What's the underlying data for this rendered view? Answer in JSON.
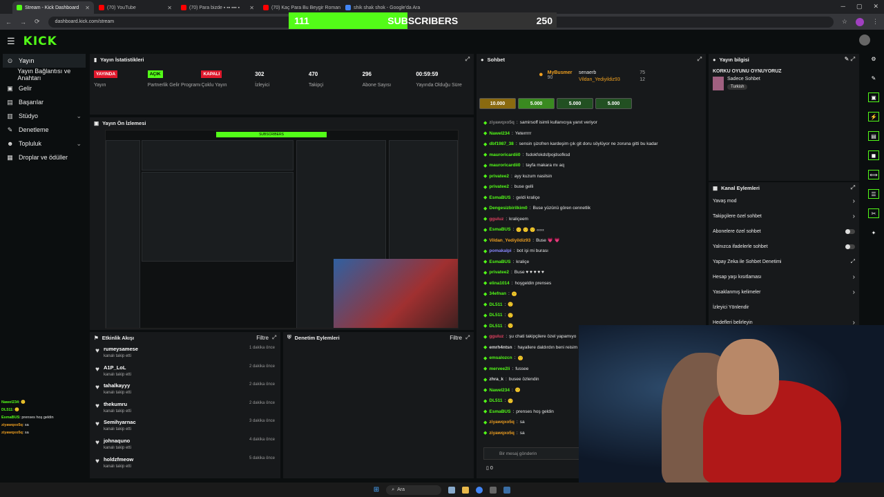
{
  "browser": {
    "tabs": [
      {
        "label": "Stream - Kick Dashboard",
        "color": "#53fc18"
      },
      {
        "label": "(70) YouTube",
        "color": "#ff0000"
      },
      {
        "label": "(70) Para bizde ▪ ▪▪ ▪▪▪ ▪",
        "color": "#ff0000"
      },
      {
        "label": "(70) Kaç Para Bu Beygir Romanl",
        "color": "#ff0000"
      },
      {
        "label": "shik shak shok - Google'da Ara",
        "color": "#4285f4"
      }
    ],
    "url": "dashboard.kick.com/stream"
  },
  "subs_goal": {
    "current": "111",
    "label": "SUBSCRIBERS",
    "goal": "250",
    "progress": 0.444
  },
  "brand": {
    "logo": "KICK"
  },
  "sidebar": {
    "items": [
      {
        "label": "Yayın",
        "icon": "⊙"
      },
      {
        "label": "Yayın Bağlantısı ve Anahtarı",
        "icon": ""
      },
      {
        "label": "Gelir",
        "icon": "▣"
      },
      {
        "label": "Başarılar",
        "icon": "▤"
      },
      {
        "label": "Stüdyo",
        "icon": "▥"
      },
      {
        "label": "Denetleme",
        "icon": "✎"
      },
      {
        "label": "Topluluk",
        "icon": "☻"
      },
      {
        "label": "Droplar ve ödüller",
        "icon": "▦"
      }
    ]
  },
  "stats": {
    "title": "Yayın İstatistikleri",
    "items": [
      {
        "value": "YAYINDA",
        "label": "Yayın",
        "badge": "red"
      },
      {
        "value": "AÇIK",
        "label": "Partnerlik Gelir Programı",
        "badge": "green"
      },
      {
        "value": "KAPALI",
        "label": "Çoklu Yayın",
        "badge": "red"
      },
      {
        "value": "302",
        "label": "İzleyici"
      },
      {
        "value": "470",
        "label": "Takipçi"
      },
      {
        "value": "296",
        "label": "Abone Sayısı"
      },
      {
        "value": "00:59:59",
        "label": "Yayında Olduğu Süre"
      }
    ]
  },
  "preview": {
    "title": "Yayın Ön İzlemesi"
  },
  "activity": {
    "title": "Etkinlik Akışı",
    "filter": "Filtre",
    "items": [
      {
        "name": "rumeysamese",
        "sub": "kanalı takip etti",
        "time": "1 dakika önce"
      },
      {
        "name": "A1P_LoL",
        "sub": "kanalı takip etti",
        "time": "2 dakika önce"
      },
      {
        "name": "tahalkayyy",
        "sub": "kanalı takip etti",
        "time": "2 dakika önce"
      },
      {
        "name": "thekumru",
        "sub": "kanalı takip etti",
        "time": "2 dakika önce"
      },
      {
        "name": "Semihyarnac",
        "sub": "kanalı takip etti",
        "time": "3 dakika önce"
      },
      {
        "name": "johnaquno",
        "sub": "kanalı takip etti",
        "time": "4 dakika önce"
      },
      {
        "name": "holdzfmeow",
        "sub": "kanalı takip etti",
        "time": "5 dakika önce"
      }
    ]
  },
  "moderation": {
    "title": "Denetim Eylemleri",
    "filter": "Filtre"
  },
  "chat": {
    "title": "Sohbet",
    "top": [
      {
        "name": "MyBusmer",
        "amount": "90"
      },
      {
        "name": "senaerb",
        "amount": "75"
      },
      {
        "name": "Vildan_Yediyildiz93",
        "amount": "12"
      }
    ],
    "tips": [
      "10.000",
      "5.000",
      "5.000",
      "5.000"
    ],
    "lines": [
      {
        "user": "ziyawqxo5q",
        "text": "samirsoff isimli kullanıcıya yanıt veriyor",
        "color": "#888"
      },
      {
        "user": "Nawel234",
        "text": "Yeterrrrr",
        "color": "#53fc18"
      },
      {
        "user": "dbf1987_38",
        "text": "sensin şizofren kardeşim çık git doru söylüyor ne zoruna gitti bu kadar",
        "color": "#53fc18"
      },
      {
        "user": "mauroricardii0",
        "text": "fsdokfokdsfpojdsofksd",
        "color": "#53fc18"
      },
      {
        "user": "mauroricardii0",
        "text": "tayfa makara mı aq",
        "color": "#53fc18"
      },
      {
        "user": "privatee2",
        "text": "ayy kuzum nasilsin",
        "color": "#53fc18"
      },
      {
        "user": "privatee2",
        "text": "buse gelli",
        "color": "#53fc18"
      },
      {
        "user": "EsmaBUS",
        "text": "geldi kraliçe",
        "color": "#53fc18"
      },
      {
        "user": "Dengesizbirilkim0",
        "text": "Buse yüzünü gören cennetlik",
        "color": "#53fc18"
      },
      {
        "user": "gguluz",
        "text": "kraliçeem",
        "color": "#e04060"
      },
      {
        "user": "EsmaBUS",
        "text": "🙂 🙂 🙂 ‹‹‹‹‹",
        "color": "#53fc18"
      },
      {
        "user": "Vildan_Yediyildiz93",
        "text": "Buse 💗 💗",
        "color": "#f0a020"
      },
      {
        "user": "pomakalpi",
        "text": "bot işi mi burası",
        "color": "#8888ff"
      },
      {
        "user": "EsmaBUS",
        "text": "kraliçe",
        "color": "#53fc18"
      },
      {
        "user": "privatee2",
        "text": "Buse ♥ ♥ ♥ ♥ ♥",
        "color": "#53fc18"
      },
      {
        "user": "elina1014",
        "text": "hoşgeldin prenses",
        "color": "#53fc18"
      },
      {
        "user": "34efnan",
        "text": "🙂",
        "color": "#53fc18"
      },
      {
        "user": "DL511",
        "text": "🙂",
        "color": "#53fc18"
      },
      {
        "user": "DL511",
        "text": "🙂",
        "color": "#53fc18"
      },
      {
        "user": "DL511",
        "text": "🙂",
        "color": "#53fc18"
      },
      {
        "user": "gguluz",
        "text": "şu chati takipçilere özel yapamıyo",
        "color": "#e04060"
      },
      {
        "user": "emrh4ntsn",
        "text": "hayallere daldırdın beni reisim iyi",
        "color": "#ddd"
      },
      {
        "user": "emsalozcn",
        "text": "🙂",
        "color": "#53fc18"
      },
      {
        "user": "mervee2li",
        "text": "fussee",
        "color": "#53fc18"
      },
      {
        "user": "zhra_k",
        "text": "busee özlendin",
        "color": "#ddd"
      },
      {
        "user": "Nawel234",
        "text": "🙂",
        "color": "#53fc18"
      },
      {
        "user": "DL511",
        "text": "🙂",
        "color": "#53fc18"
      },
      {
        "user": "EsmaBUS",
        "text": "prenses hoş geldin",
        "color": "#53fc18"
      },
      {
        "user": "ziyawqxo5q",
        "text": "sa",
        "color": "#f0a020"
      },
      {
        "user": "ziyawqxo5q",
        "text": "sa",
        "color": "#f0a020"
      }
    ],
    "input_placeholder": "Bir mesaj gönderin",
    "viewer_count": "0"
  },
  "streaminfo": {
    "title": "Yayın bilgisi",
    "stream_title": "KORKU OYUNU OYNUYORUZ",
    "mode": "Sadece Sohbet",
    "lang": "Turkish"
  },
  "actions": {
    "title": "Kanal Eylemleri",
    "items": [
      {
        "label": "Yavaş mod",
        "type": "arrow"
      },
      {
        "label": "Takipçilere özel sohbet",
        "type": "arrow"
      },
      {
        "label": "Abonelere özel sohbet",
        "type": "toggle"
      },
      {
        "label": "Yalnızca ifadelerle sohbet",
        "type": "toggle"
      },
      {
        "label": "Yapay Zeka ile Sohbet Denetimi",
        "type": "ext"
      },
      {
        "label": "Hesap yaşı kısıtlaması",
        "type": "arrow"
      },
      {
        "label": "Yasaklanmış kelimeler",
        "type": "arrow"
      },
      {
        "label": "İzleyici Yönlendir",
        "type": "none"
      },
      {
        "label": "Hedefleri belirleyin",
        "type": "arrow"
      }
    ]
  },
  "overlay_chat": [
    {
      "user": "Nawel234",
      "text": ": 🙂",
      "color": "#53fc18"
    },
    {
      "user": "DL511",
      "text": ": 🙂",
      "color": "#53fc18"
    },
    {
      "user": "EsmaBUS",
      "text": ": prenses hoş geldin",
      "color": "#53fc18"
    },
    {
      "user": "ziyawqxo5q",
      "text": ": sa",
      "color": "#f0a020"
    },
    {
      "user": "ziyawqxo5q",
      "text": ": sa",
      "color": "#f0a020"
    }
  ],
  "taskbar": {
    "search": "Ara"
  }
}
